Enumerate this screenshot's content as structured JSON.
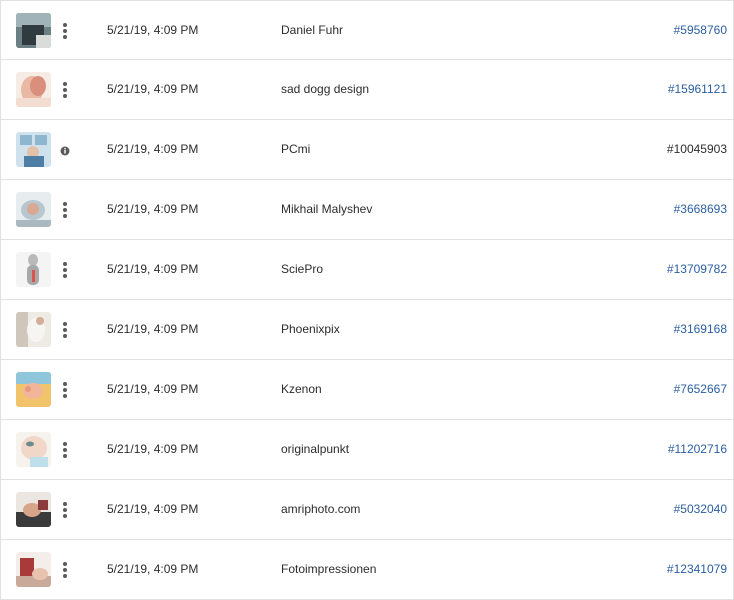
{
  "rows": [
    {
      "thumb_icon": "asset-thumbnail-image",
      "menu_icon": "more-vertical-icon",
      "date": "5/21/19, 4:09 PM",
      "author": "Daniel Fuhr",
      "id": "#5958760",
      "id_linked": true
    },
    {
      "thumb_icon": "asset-thumbnail-image",
      "menu_icon": "more-vertical-icon",
      "date": "5/21/19, 4:09 PM",
      "author": "sad dogg design",
      "id": "#15961121",
      "id_linked": true
    },
    {
      "thumb_icon": "asset-thumbnail-image",
      "menu_icon": "info-icon",
      "date": "5/21/19, 4:09 PM",
      "author": "PCmi",
      "id": "#10045903",
      "id_linked": false
    },
    {
      "thumb_icon": "asset-thumbnail-image",
      "menu_icon": "more-vertical-icon",
      "date": "5/21/19, 4:09 PM",
      "author": "Mikhail Malyshev",
      "id": "#3668693",
      "id_linked": true
    },
    {
      "thumb_icon": "asset-thumbnail-image",
      "menu_icon": "more-vertical-icon",
      "date": "5/21/19, 4:09 PM",
      "author": "SciePro",
      "id": "#13709782",
      "id_linked": true
    },
    {
      "thumb_icon": "asset-thumbnail-image",
      "menu_icon": "more-vertical-icon",
      "date": "5/21/19, 4:09 PM",
      "author": "Phoenixpix",
      "id": "#3169168",
      "id_linked": true
    },
    {
      "thumb_icon": "asset-thumbnail-image",
      "menu_icon": "more-vertical-icon",
      "date": "5/21/19, 4:09 PM",
      "author": "Kzenon",
      "id": "#7652667",
      "id_linked": true
    },
    {
      "thumb_icon": "asset-thumbnail-image",
      "menu_icon": "more-vertical-icon",
      "date": "5/21/19, 4:09 PM",
      "author": "originalpunkt",
      "id": "#11202716",
      "id_linked": true
    },
    {
      "thumb_icon": "asset-thumbnail-image",
      "menu_icon": "more-vertical-icon",
      "date": "5/21/19, 4:09 PM",
      "author": "amriphoto.com",
      "id": "#5032040",
      "id_linked": true
    },
    {
      "thumb_icon": "asset-thumbnail-image",
      "menu_icon": "more-vertical-icon",
      "date": "5/21/19, 4:09 PM",
      "author": "Fotoimpressionen",
      "id": "#12341079",
      "id_linked": true
    }
  ],
  "colors": {
    "link": "#2b5ea1",
    "text": "#2c2c2c",
    "divider": "#e1e1e1",
    "icon": "#5a5a5a"
  }
}
